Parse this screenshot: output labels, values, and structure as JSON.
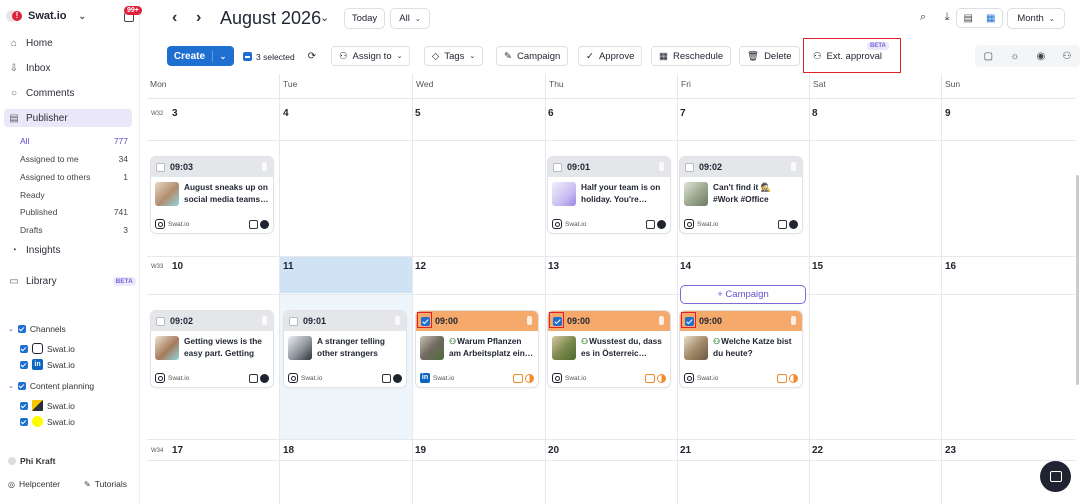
{
  "sidebar": {
    "brand": "Swat.io",
    "notifications": "99+",
    "nav": {
      "home": "Home",
      "inbox": "Inbox",
      "comments": "Comments",
      "publisher": "Publisher",
      "insights": "Insights",
      "library": "Library",
      "library_badge": "BETA"
    },
    "publisher_filters": [
      {
        "label": "All",
        "count": "777"
      },
      {
        "label": "Assigned to me",
        "count": "34"
      },
      {
        "label": "Assigned to others",
        "count": "1"
      },
      {
        "label": "Ready",
        "count": ""
      },
      {
        "label": "Published",
        "count": "741"
      },
      {
        "label": "Drafts",
        "count": "3"
      }
    ],
    "channels": {
      "label": "Channels",
      "items": [
        "Swat.io",
        "Swat.io"
      ]
    },
    "content_planning": {
      "label": "Content planning",
      "items": [
        "Swat.io",
        "Swat.io"
      ]
    },
    "user": "Phi Kraft",
    "helpcenter": "Helpcenter",
    "tutorials": "Tutorials"
  },
  "topbar": {
    "month": "August 2026",
    "today": "Today",
    "filter": "All",
    "view": "Month"
  },
  "actions": {
    "create": "Create",
    "selected": "3 selected",
    "assign": "Assign to",
    "tags": "Tags",
    "campaign": "Campaign",
    "approve": "Approve",
    "reschedule": "Reschedule",
    "delete": "Delete",
    "ext_approval": "Ext. approval",
    "ext_badge": "BETA"
  },
  "calendar": {
    "days": [
      "Mon",
      "Tue",
      "Wed",
      "Thu",
      "Fri",
      "Sat",
      "Sun"
    ],
    "weeks": [
      {
        "label": "W32",
        "dates": [
          "3",
          "4",
          "5",
          "6",
          "7",
          "8",
          "9"
        ]
      },
      {
        "label": "W33",
        "dates": [
          "10",
          "11",
          "12",
          "13",
          "14",
          "15",
          "16"
        ]
      },
      {
        "label": "W34",
        "dates": [
          "17",
          "18",
          "19",
          "20",
          "21",
          "22",
          "23"
        ]
      }
    ],
    "add_campaign": "+ Campaign",
    "posts": [
      {
        "time": "09:03",
        "text": "August sneaks up on social media teams…",
        "account": "Swat.io",
        "network": "instagram",
        "selected": false
      },
      {
        "time": "09:01",
        "text": "Half your team is on holiday. You're…",
        "account": "Swat.io",
        "network": "instagram",
        "selected": false
      },
      {
        "time": "09:02",
        "text": "Can't find it 🕵 #Work #Office #Corporate…",
        "account": "Swat.io",
        "network": "instagram",
        "selected": false
      },
      {
        "time": "09:02",
        "text": "Getting views is the easy part. Getting th…",
        "account": "Swat.io",
        "network": "instagram",
        "selected": false
      },
      {
        "time": "09:01",
        "text": "A stranger telling other strangers your…",
        "account": "Swat.io",
        "network": "instagram",
        "selected": false
      },
      {
        "time": "09:00",
        "text": "Warum Pflanzen am Arbeitsplatz ein…",
        "account": "Swat.io",
        "network": "linkedin",
        "selected": true
      },
      {
        "time": "09:00",
        "text": "Wusstest du, dass es in Österreic…",
        "account": "Swat.io",
        "network": "instagram",
        "selected": true
      },
      {
        "time": "09:00",
        "text": "Welche Katze bist du heute?",
        "account": "Swat.io",
        "network": "instagram",
        "selected": true
      }
    ]
  }
}
